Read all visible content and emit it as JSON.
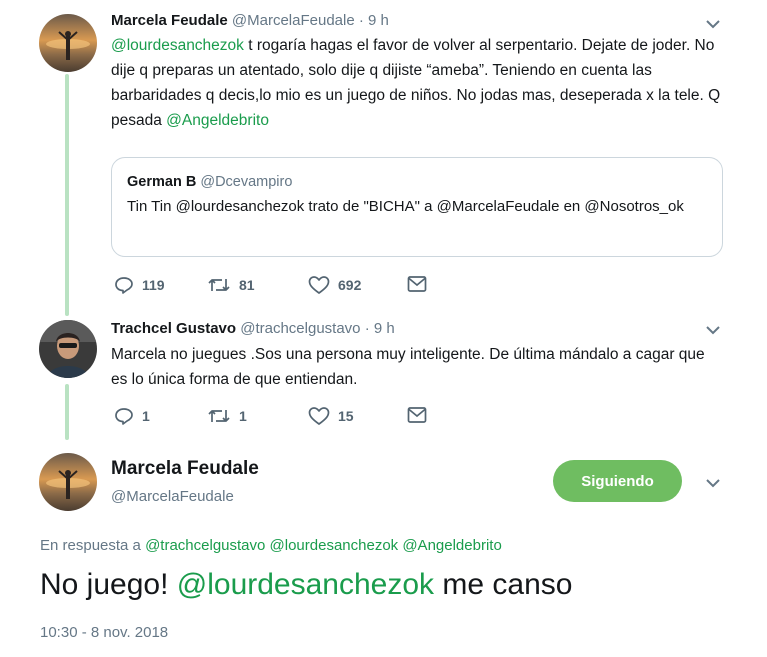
{
  "tweets": [
    {
      "name": "Marcela Feudale",
      "handle": "@MarcelaFeudale",
      "time": "· 9 h",
      "text_parts": [
        {
          "text": "@lourdesanchezok",
          "mention": true
        },
        {
          "text": " t rogaría hagas el favor de volver al serpentario. Dejate de joder. No dije q preparas un atentado, solo dije q dijiste “ameba”. Teniendo en cuenta las barbaridades q decis,lo mio es un juego de niños. No jodas mas, deseperada x la tele. Q pesada ",
          "mention": false
        },
        {
          "text": "@Angeldebrito",
          "mention": true
        }
      ],
      "quote": {
        "name": "German B",
        "handle": "@Dcevampiro",
        "text": "Tin Tin @lourdesanchezok trato de \"BICHA\" a @MarcelaFeudale en @Nosotros_ok"
      },
      "actions": {
        "reply": "119",
        "retweet": "81",
        "like": "692"
      }
    },
    {
      "name": "Trachcel Gustavo",
      "handle": "@trachcelgustavo",
      "time": "· 9 h",
      "text": "Marcela no juegues .Sos una persona muy inteligente. De última mándalo a cagar que es lo única forma de que entiendan.",
      "actions": {
        "reply": "1",
        "retweet": "1",
        "like": "15"
      }
    }
  ],
  "main_tweet": {
    "name": "Marcela Feudale",
    "handle": "@MarcelaFeudale",
    "follow_label": "Siguiendo",
    "reply_prefix": "En respuesta a",
    "reply_mentions": "@trachcelgustavo @lourdesanchezok @Angeldebrito",
    "text_before": "No juego! ",
    "text_mention": "@lourdesanchezok",
    "text_after": " me canso",
    "timestamp": "10:30 - 8 nov. 2018"
  },
  "colors": {
    "accent": "#1a9c4c",
    "follow_button": "#6fbd61",
    "thread_line": "#b9e2c2",
    "muted": "#657786"
  },
  "icons": [
    "reply-icon",
    "retweet-icon",
    "like-icon",
    "message-icon",
    "chevron-down-icon"
  ]
}
